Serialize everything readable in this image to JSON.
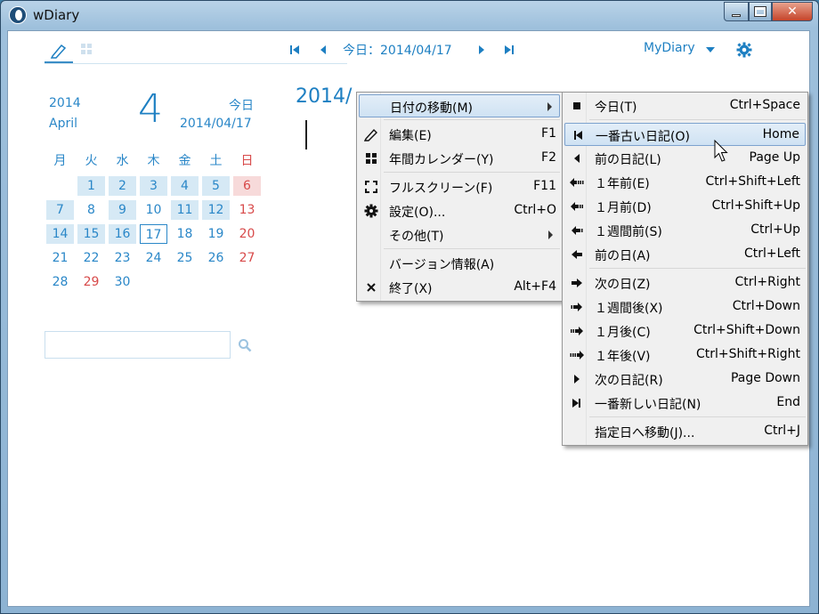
{
  "window": {
    "title": "wDiary"
  },
  "toolbar": {
    "today_label": "今日：2014/04/17",
    "diary_name": "MyDiary"
  },
  "calendar": {
    "year": "2014",
    "month_name": "April",
    "big_month": "4",
    "today_label": "今日",
    "today_date": "2014/04/17",
    "weekdays": [
      "月",
      "火",
      "水",
      "木",
      "金",
      "土",
      "日"
    ],
    "weeks": [
      [
        "",
        "1",
        "2",
        "3",
        "4",
        "5",
        "6"
      ],
      [
        "7",
        "8",
        "9",
        "10",
        "11",
        "12",
        "13"
      ],
      [
        "14",
        "15",
        "16",
        "17",
        "18",
        "19",
        "20"
      ],
      [
        "21",
        "22",
        "23",
        "24",
        "25",
        "26",
        "27"
      ],
      [
        "28",
        "29",
        "30",
        "",
        "",
        "",
        ""
      ]
    ],
    "days_with_entries": [
      "1",
      "2",
      "3",
      "4",
      "5",
      "6",
      "7",
      "9",
      "11",
      "12",
      "14",
      "15",
      "16"
    ],
    "today_day": "17",
    "holiday_days": [
      "29"
    ]
  },
  "search": {
    "placeholder": ""
  },
  "editor": {
    "entry_date": "2014/"
  },
  "main_menu": {
    "items": [
      {
        "label": "日付の移動(M)",
        "shortcut": "",
        "icon": "",
        "submenu": true
      },
      {
        "label": "編集(E)",
        "shortcut": "F1",
        "icon": "pencil-icon"
      },
      {
        "label": "年間カレンダー(Y)",
        "shortcut": "F2",
        "icon": "grid-icon"
      },
      {
        "label": "フルスクリーン(F)",
        "shortcut": "F11",
        "icon": "fullscreen-icon"
      },
      {
        "label": "設定(O)...",
        "shortcut": "Ctrl+O",
        "icon": "gear-icon"
      },
      {
        "label": "その他(T)",
        "shortcut": "",
        "icon": "",
        "submenu": true
      },
      {
        "label": "バージョン情報(A)",
        "shortcut": "",
        "icon": ""
      },
      {
        "label": "終了(X)",
        "shortcut": "Alt+F4",
        "icon": "close-icon"
      }
    ]
  },
  "date_submenu": {
    "items": [
      {
        "label": "今日(T)",
        "shortcut": "Ctrl+Space",
        "icon": "stop-icon"
      },
      {
        "label": "一番古い日記(O)",
        "shortcut": "Home",
        "icon": "first-icon"
      },
      {
        "label": "前の日記(L)",
        "shortcut": "Page Up",
        "icon": "prev-icon"
      },
      {
        "label": "１年前(E)",
        "shortcut": "Ctrl+Shift+Left",
        "icon": "arrow-left-3-icon"
      },
      {
        "label": "１月前(D)",
        "shortcut": "Ctrl+Shift+Up",
        "icon": "arrow-left-2-icon"
      },
      {
        "label": "１週間前(S)",
        "shortcut": "Ctrl+Up",
        "icon": "arrow-left-1-icon"
      },
      {
        "label": "前の日(A)",
        "shortcut": "Ctrl+Left",
        "icon": "arrow-left-icon"
      },
      {
        "label": "次の日(Z)",
        "shortcut": "Ctrl+Right",
        "icon": "arrow-right-icon"
      },
      {
        "label": "１週間後(X)",
        "shortcut": "Ctrl+Down",
        "icon": "arrow-right-1-icon"
      },
      {
        "label": "１月後(C)",
        "shortcut": "Ctrl+Shift+Down",
        "icon": "arrow-right-2-icon"
      },
      {
        "label": "１年後(V)",
        "shortcut": "Ctrl+Shift+Right",
        "icon": "arrow-right-3-icon"
      },
      {
        "label": "次の日記(R)",
        "shortcut": "Page Down",
        "icon": "next-icon"
      },
      {
        "label": "一番新しい日記(N)",
        "shortcut": "End",
        "icon": "last-icon"
      },
      {
        "label": "指定日へ移動(J)...",
        "shortcut": "Ctrl+J",
        "icon": ""
      }
    ]
  },
  "colors": {
    "accent": "#1d7fc2",
    "sunday": "#d84a4a",
    "entry_bg": "#d6e9f5"
  }
}
